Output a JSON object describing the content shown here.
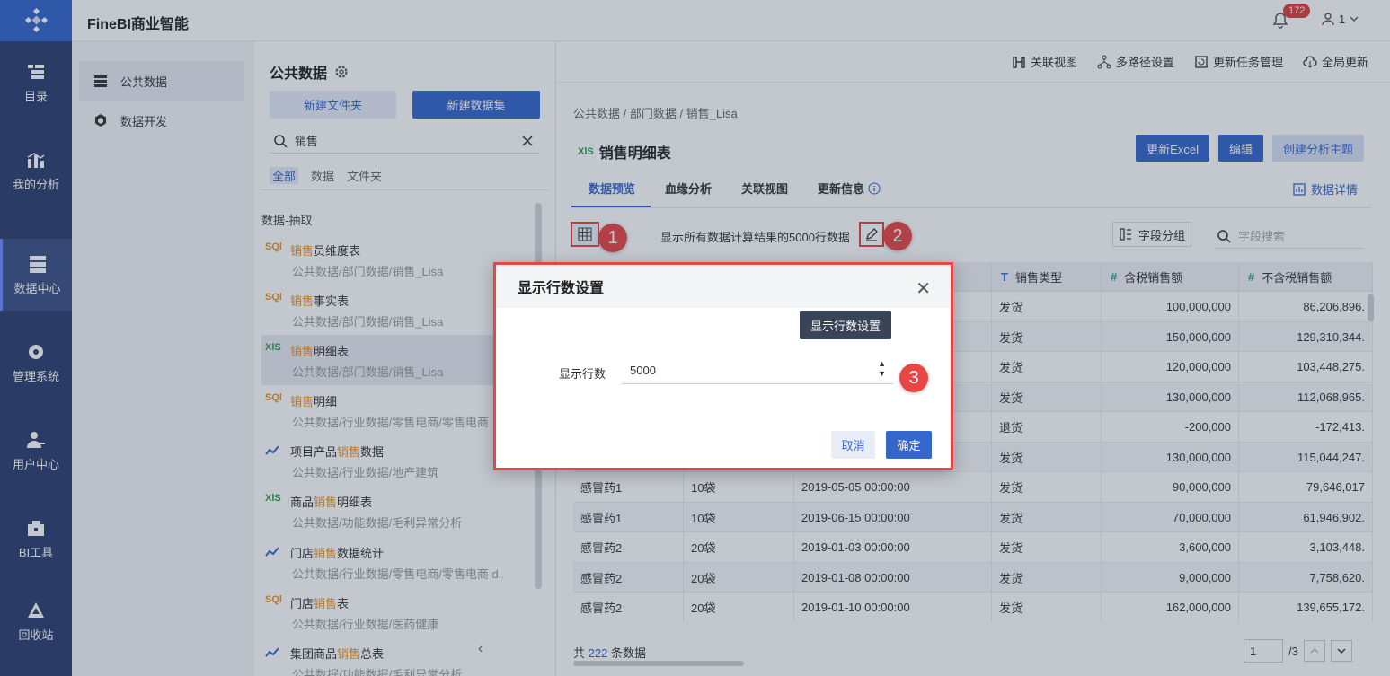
{
  "app": {
    "title": "FineBI商业智能",
    "notif_count": "172",
    "user": "1"
  },
  "leftnav": [
    {
      "label": "目录",
      "icon": "catalog-icon"
    },
    {
      "label": "我的分析",
      "icon": "analysis-icon"
    },
    {
      "label": "数据中心",
      "icon": "data-center-icon"
    },
    {
      "label": "管理系统",
      "icon": "management-icon"
    },
    {
      "label": "用户中心",
      "icon": "user-center-icon"
    },
    {
      "label": "BI工具",
      "icon": "toolbox-icon"
    },
    {
      "label": "回收站",
      "icon": "recycle-icon"
    }
  ],
  "panel1": {
    "items": [
      "公共数据",
      "数据开发"
    ]
  },
  "panel2": {
    "title": "公共数据",
    "new_folder": "新建文件夹",
    "new_dataset": "新建数据集",
    "search_value": "销售",
    "filters": [
      "全部",
      "数据",
      "文件夹"
    ],
    "group_label": "数据-抽取",
    "results": [
      {
        "type": "sql",
        "pre": "",
        "hl": "销售",
        "post": "员维度表",
        "path": "公共数据/部门数据/销售_Lisa"
      },
      {
        "type": "sql",
        "pre": "",
        "hl": "销售",
        "post": "事实表",
        "path": "公共数据/部门数据/销售_Lisa"
      },
      {
        "type": "xls",
        "pre": "",
        "hl": "销售",
        "post": "明细表",
        "path": "公共数据/部门数据/销售_Lisa"
      },
      {
        "type": "sql",
        "pre": "",
        "hl": "销售",
        "post": "明细",
        "path": "公共数据/行业数据/零售电商/零售电商"
      },
      {
        "type": "self",
        "pre": "项目产品",
        "hl": "销售",
        "post": "数据",
        "path": "公共数据/行业数据/地产建筑"
      },
      {
        "type": "xls",
        "pre": "商品",
        "hl": "销售",
        "post": "明细表",
        "path": "公共数据/功能数据/毛利异常分析"
      },
      {
        "type": "self",
        "pre": "门店",
        "hl": "销售",
        "post": "数据统计",
        "path": "公共数据/行业数据/零售电商/零售电商 d..."
      },
      {
        "type": "sql",
        "pre": "门店",
        "hl": "销售",
        "post": "表",
        "path": "公共数据/行业数据/医药健康"
      },
      {
        "type": "self",
        "pre": "集团商品",
        "hl": "销售",
        "post": "总表",
        "path": "公共数据/功能数据/毛利异常分析"
      }
    ]
  },
  "main": {
    "toolbar": [
      "关联视图",
      "多路径设置",
      "更新任务管理",
      "全局更新"
    ],
    "breadcrumb": "公共数据  /  部门数据  /  销售_Lisa",
    "table_title": "销售明细表",
    "actions": [
      "更新Excel",
      "编辑",
      "创建分析主题"
    ],
    "tabs": [
      "数据预览",
      "血缘分析",
      "关联视图",
      "更新信息"
    ],
    "detail_link": "数据详情",
    "hint": "显示所有数据计算结果的5000行数据",
    "field_group": "字段分组",
    "field_search_placeholder": "字段搜索",
    "headers": [
      {
        "label": "销售类型",
        "type": "T"
      },
      {
        "label": "含税销售额",
        "type": "#"
      },
      {
        "label": "不含税销售额",
        "type": "#"
      }
    ],
    "rows": [
      [
        "",
        "",
        "",
        "发货",
        "100,000,000",
        "86,206,896."
      ],
      [
        "",
        "",
        "",
        "发货",
        "150,000,000",
        "129,310,344."
      ],
      [
        "",
        "",
        "",
        "发货",
        "120,000,000",
        "103,448,275."
      ],
      [
        "",
        "",
        "",
        "发货",
        "130,000,000",
        "112,068,965."
      ],
      [
        "",
        "",
        "",
        "退货",
        "-200,000",
        "-172,413."
      ],
      [
        "",
        "",
        "",
        "发货",
        "130,000,000",
        "115,044,247."
      ],
      [
        "感冒药1",
        "10袋",
        "2019-05-05 00:00:00",
        "发货",
        "90,000,000",
        "79,646,017"
      ],
      [
        "感冒药1",
        "10袋",
        "2019-06-15 00:00:00",
        "发货",
        "70,000,000",
        "61,946,902."
      ],
      [
        "感冒药2",
        "20袋",
        "2019-01-03 00:00:00",
        "发货",
        "3,600,000",
        "3,103,448."
      ],
      [
        "感冒药2",
        "20袋",
        "2019-01-08 00:00:00",
        "发货",
        "9,000,000",
        "7,758,620."
      ],
      [
        "感冒药2",
        "20袋",
        "2019-01-10 00:00:00",
        "发货",
        "162,000,000",
        "139,655,172."
      ]
    ],
    "footer": {
      "prefix": "共",
      "count": "222",
      "suffix": "条数据",
      "page": "1",
      "total": "/3"
    }
  },
  "dialog": {
    "title": "显示行数设置",
    "tooltip": "显示行数设置",
    "label": "显示行数",
    "value": "5000",
    "cancel": "取消",
    "ok": "确定"
  },
  "markers": [
    "1",
    "2",
    "3"
  ],
  "colors": {
    "primary": "#3466cc",
    "nav": "#2b3f6e",
    "highlight": "#e8921e",
    "marker": "#e84545"
  }
}
